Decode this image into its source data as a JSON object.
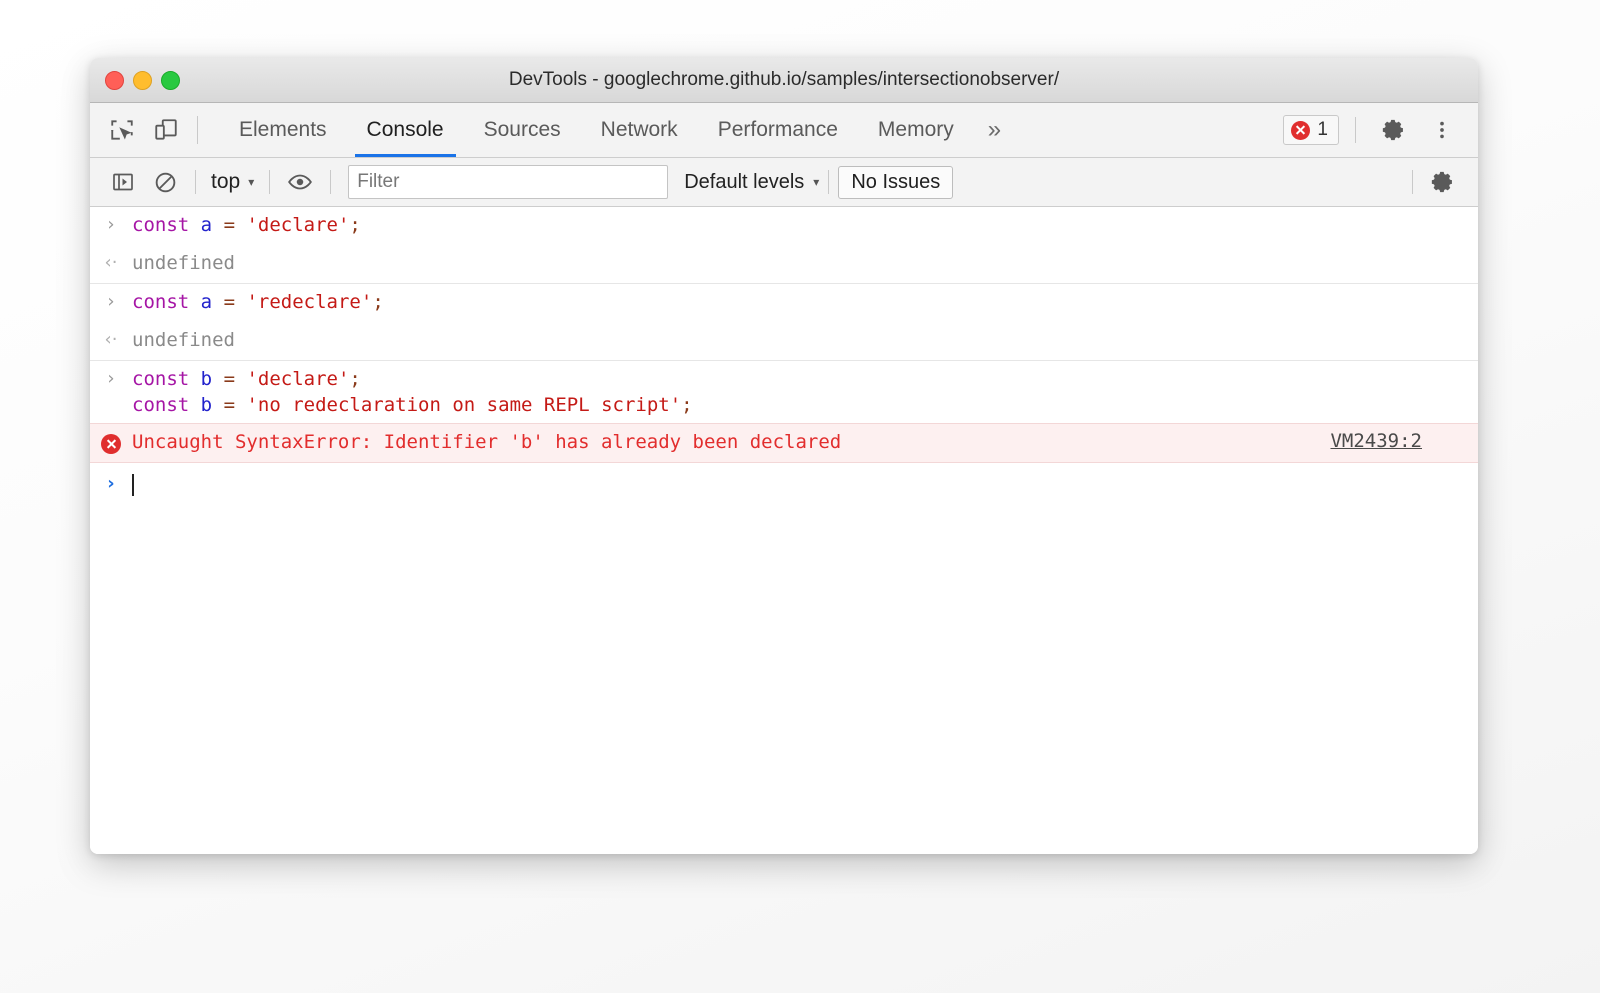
{
  "window": {
    "title": "DevTools - googlechrome.github.io/samples/intersectionobserver/",
    "traffic_lights": [
      "close-red",
      "minimize-yellow",
      "zoom-green"
    ]
  },
  "tabbar": {
    "inspect_icon": "inspect-element-icon",
    "device_icon": "device-toolbar-icon",
    "tabs": [
      {
        "label": "Elements",
        "active": false
      },
      {
        "label": "Console",
        "active": true
      },
      {
        "label": "Sources",
        "active": false
      },
      {
        "label": "Network",
        "active": false
      },
      {
        "label": "Performance",
        "active": false
      },
      {
        "label": "Memory",
        "active": false
      }
    ],
    "more_tabs_label": "»",
    "error_count": "1",
    "error_icon": "error-circle-icon",
    "settings_icon": "gear-icon",
    "menu_icon": "more-vertical-icon"
  },
  "consolebar": {
    "sidebar_toggle_icon": "console-sidebar-icon",
    "clear_icon": "clear-console-icon",
    "context": "top",
    "context_caret": "▾",
    "eye_icon": "live-expression-eye-icon",
    "filter_placeholder": "Filter",
    "filter_value": "",
    "levels_label": "Default levels",
    "levels_caret": "▾",
    "issues_label": "No Issues",
    "settings_icon": "console-settings-gear-icon"
  },
  "console": {
    "input_chevron": "›",
    "output_chevron": "‹·",
    "prompt_chevron": "›",
    "entries": [
      {
        "type": "input",
        "tokens": [
          {
            "t": "const",
            "c": "kw"
          },
          {
            "t": " ",
            "c": ""
          },
          {
            "t": "a",
            "c": "var"
          },
          {
            "t": " ",
            "c": ""
          },
          {
            "t": "=",
            "c": "op"
          },
          {
            "t": " ",
            "c": ""
          },
          {
            "t": "'declare'",
            "c": "str"
          },
          {
            "t": ";",
            "c": "op"
          }
        ]
      },
      {
        "type": "output",
        "text": "undefined"
      },
      {
        "type": "input",
        "tokens": [
          {
            "t": "const",
            "c": "kw"
          },
          {
            "t": " ",
            "c": ""
          },
          {
            "t": "a",
            "c": "var"
          },
          {
            "t": " ",
            "c": ""
          },
          {
            "t": "=",
            "c": "op"
          },
          {
            "t": " ",
            "c": ""
          },
          {
            "t": "'redeclare'",
            "c": "str"
          },
          {
            "t": ";",
            "c": "op"
          }
        ]
      },
      {
        "type": "output",
        "text": "undefined"
      },
      {
        "type": "input",
        "tokens": [
          {
            "t": "const",
            "c": "kw"
          },
          {
            "t": " ",
            "c": ""
          },
          {
            "t": "b",
            "c": "var"
          },
          {
            "t": " ",
            "c": ""
          },
          {
            "t": "=",
            "c": "op"
          },
          {
            "t": " ",
            "c": ""
          },
          {
            "t": "'declare'",
            "c": "str"
          },
          {
            "t": ";\n",
            "c": "op"
          },
          {
            "t": "const",
            "c": "kw"
          },
          {
            "t": " ",
            "c": ""
          },
          {
            "t": "b",
            "c": "var"
          },
          {
            "t": " ",
            "c": ""
          },
          {
            "t": "=",
            "c": "op"
          },
          {
            "t": " ",
            "c": ""
          },
          {
            "t": "'no redeclaration on same REPL script'",
            "c": "str"
          },
          {
            "t": ";",
            "c": "op"
          }
        ]
      },
      {
        "type": "error",
        "text": "Uncaught SyntaxError: Identifier 'b' has already been declared",
        "source_link": "VM2439:2"
      },
      {
        "type": "prompt",
        "text": ""
      }
    ]
  },
  "colors": {
    "accent_blue": "#1a73e8",
    "error_red": "#e02e2e",
    "error_bg": "#fdf0f0",
    "keyword": "#a515a5",
    "variable": "#2222cc",
    "string": "#c41a16",
    "operator": "#8a3a1a",
    "muted_text": "#8a8a8a"
  }
}
